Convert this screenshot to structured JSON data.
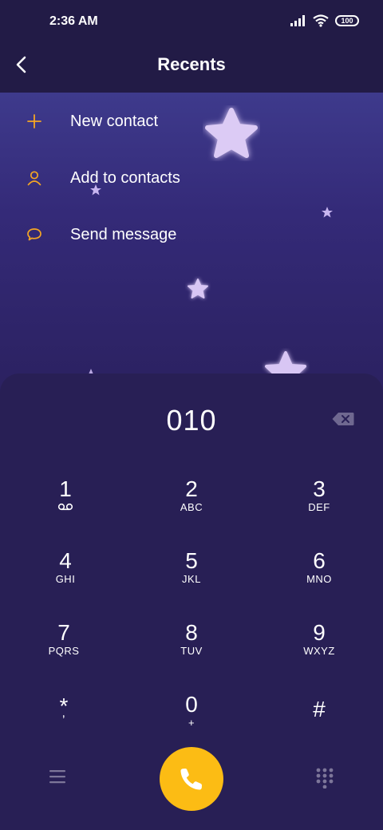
{
  "status_bar": {
    "time": "2:36 AM",
    "battery": "100"
  },
  "header": {
    "title": "Recents"
  },
  "menu": {
    "items": [
      {
        "label": "New contact",
        "icon": "plus-icon"
      },
      {
        "label": "Add to contacts",
        "icon": "person-icon"
      },
      {
        "label": "Send message",
        "icon": "chat-bubble-icon"
      }
    ]
  },
  "dialer": {
    "number": "010",
    "keys": [
      {
        "digit": "1",
        "letters": ""
      },
      {
        "digit": "2",
        "letters": "ABC"
      },
      {
        "digit": "3",
        "letters": "DEF"
      },
      {
        "digit": "4",
        "letters": "GHI"
      },
      {
        "digit": "5",
        "letters": "JKL"
      },
      {
        "digit": "6",
        "letters": "MNO"
      },
      {
        "digit": "7",
        "letters": "PQRS"
      },
      {
        "digit": "8",
        "letters": "TUV"
      },
      {
        "digit": "9",
        "letters": "WXYZ"
      },
      {
        "digit": "*",
        "letters": ","
      },
      {
        "digit": "0",
        "letters": "+"
      },
      {
        "digit": "#",
        "letters": ""
      }
    ]
  },
  "colors": {
    "accent": "#fcbc14",
    "icon_orange": "#f5a623",
    "panel": "#281f55",
    "header": "#221b46"
  }
}
